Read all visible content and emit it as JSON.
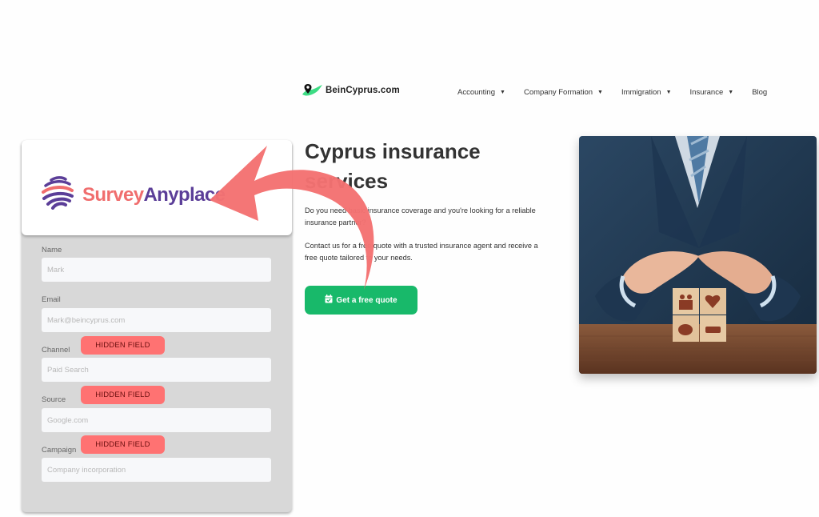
{
  "site": {
    "brand": "BeinCyprus.com",
    "nav": [
      {
        "label": "Accounting",
        "has_dropdown": true
      },
      {
        "label": "Company Formation",
        "has_dropdown": true
      },
      {
        "label": "Immigration",
        "has_dropdown": true
      },
      {
        "label": "Insurance",
        "has_dropdown": true
      },
      {
        "label": "Blog",
        "has_dropdown": false
      }
    ],
    "caret": "▼"
  },
  "hero": {
    "title_line1": "Cyprus insurance",
    "title_line2": "services",
    "paragraph1": "Do you need basic insurance coverage and you're looking for a reliable insurance partner?",
    "paragraph2": "Contact us for a free quote with a trusted insurance agent and receive a free quote tailored to your needs.",
    "cta_label": "Get a free quote",
    "cta_icon": "calendar-check-icon",
    "image_alt": "Businessman protecting wooden blocks with family, health, savings and car icons"
  },
  "survey": {
    "brand_part1": "Survey",
    "brand_part2": "Anyplace",
    "fields": [
      {
        "label": "Name",
        "placeholder": "Mark",
        "hidden": false
      },
      {
        "label": "Email",
        "placeholder": "Mark@beincyprus.com",
        "hidden": false
      },
      {
        "label": "Channel",
        "placeholder": "Paid Search",
        "hidden": true
      },
      {
        "label": "Source",
        "placeholder": "Google.com",
        "hidden": true
      },
      {
        "label": "Campaign",
        "placeholder": "Company incorporation",
        "hidden": true
      }
    ],
    "hidden_badge_label": "HIDDEN FIELD"
  },
  "colors": {
    "accent_green": "#18b96a",
    "annotation_red": "#f47272",
    "survey_coral": "#f06e6e",
    "survey_purple": "#5b3e98"
  }
}
